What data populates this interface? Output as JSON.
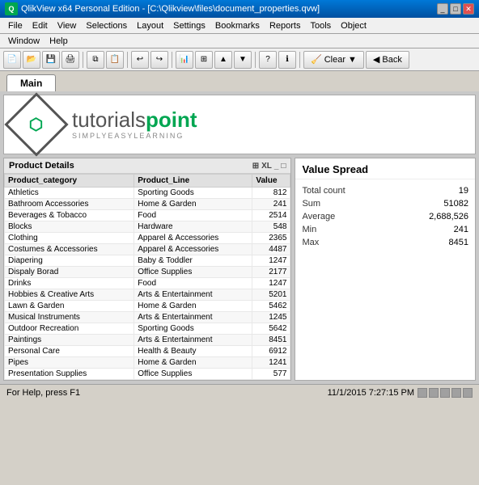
{
  "title_bar": {
    "title": "QlikView x64 Personal Edition - [C:\\Qlikview\\files\\document_properties.qvw]",
    "icon": "Q",
    "controls": [
      "minimize",
      "maximize",
      "close"
    ]
  },
  "menu": {
    "items": [
      "File",
      "Edit",
      "View",
      "Selections",
      "Layout",
      "Settings",
      "Bookmarks",
      "Reports",
      "Tools",
      "Object",
      "Window",
      "Help"
    ]
  },
  "toolbar": {
    "clear_label": "Clear",
    "back_label": "Back"
  },
  "tabs": [
    {
      "label": "Main",
      "active": true
    }
  ],
  "logo": {
    "brand": "tutorialspoint",
    "tagline": "SIMPLYEASYLEARNING"
  },
  "product_panel": {
    "title": "Product Details",
    "columns": [
      "Product_category",
      "Product_Line",
      "Value"
    ],
    "rows": [
      {
        "category": "Athletics",
        "line": "Sporting Goods",
        "value": "812"
      },
      {
        "category": "Bathroom Accessories",
        "line": "Home & Garden",
        "value": "241"
      },
      {
        "category": "Beverages & Tobacco",
        "line": "Food",
        "value": "2514"
      },
      {
        "category": "Blocks",
        "line": "Hardware",
        "value": "548"
      },
      {
        "category": "Clothing",
        "line": "Apparel & Accessories",
        "value": "2365"
      },
      {
        "category": "Costumes & Accessories",
        "line": "Apparel & Accessories",
        "value": "4487"
      },
      {
        "category": "Diapering",
        "line": "Baby & Toddler",
        "value": "1247"
      },
      {
        "category": "Dispaly Borad",
        "line": "Office Supplies",
        "value": "2177"
      },
      {
        "category": "Drinks",
        "line": "Food",
        "value": "1247"
      },
      {
        "category": "Hobbies & Creative Arts",
        "line": "Arts & Entertainment",
        "value": "5201"
      },
      {
        "category": "Lawn & Garden",
        "line": "Home & Garden",
        "value": "5462"
      },
      {
        "category": "Musical Instruments",
        "line": "Arts & Entertainment",
        "value": "1245"
      },
      {
        "category": "Outdoor Recreation",
        "line": "Sporting Goods",
        "value": "5642"
      },
      {
        "category": "Paintings",
        "line": "Arts & Entertainment",
        "value": "8451"
      },
      {
        "category": "Personal Care",
        "line": "Health & Beauty",
        "value": "6912"
      },
      {
        "category": "Pipes",
        "line": "Home & Garden",
        "value": "1241"
      },
      {
        "category": "Presentation Supplies",
        "line": "Office Supplies",
        "value": "577"
      }
    ]
  },
  "value_panel": {
    "title": "Value Spread",
    "stats": [
      {
        "label": "Total count",
        "value": "19"
      },
      {
        "label": "Sum",
        "value": "51082"
      },
      {
        "label": "Average",
        "value": "2,688,526"
      },
      {
        "label": "Min",
        "value": "241"
      },
      {
        "label": "Max",
        "value": "8451"
      }
    ]
  },
  "status_bar": {
    "help_text": "For Help, press F1",
    "datetime": "11/1/2015 7:27:15 PM"
  }
}
